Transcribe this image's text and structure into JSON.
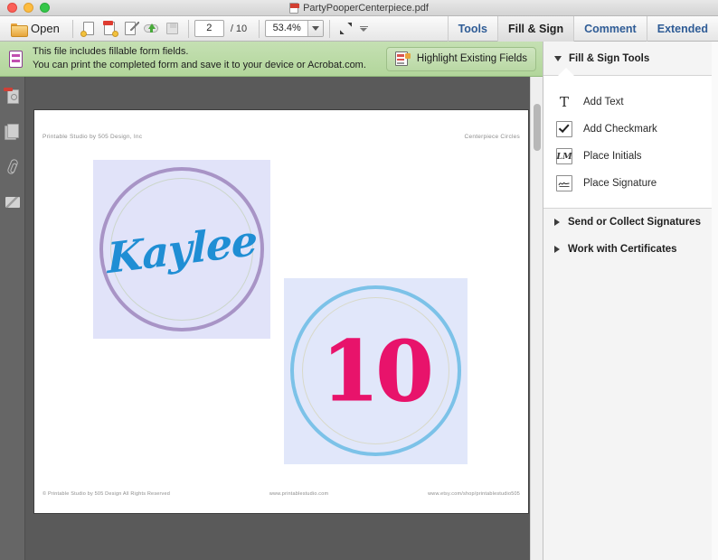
{
  "window": {
    "title": "PartyPooperCenterpiece.pdf",
    "doc_icon": "pdf-file-icon",
    "controls": {
      "close": "close-window-button",
      "minimize": "minimize-window-button",
      "maximize": "maximize-window-button"
    }
  },
  "toolbar": {
    "open_label": "Open",
    "open_icon": "folder-open-icon",
    "icons": [
      {
        "name": "save-a-copy-icon"
      },
      {
        "name": "attach-file-icon"
      },
      {
        "name": "edit-pdf-icon"
      },
      {
        "name": "upload-to-cloud-icon"
      },
      {
        "name": "save-file-icon"
      }
    ],
    "page_number": "2",
    "page_total": "/ 10",
    "zoom_value": "53.4%",
    "zoom_dropdown_icon": "chevron-down-icon",
    "fit_icon": "fit-page-icon",
    "overflow_icon": "toolbar-overflow-icon",
    "menus": [
      {
        "label": "Tools",
        "active": false
      },
      {
        "label": "Fill & Sign",
        "active": true
      },
      {
        "label": "Comment",
        "active": false
      },
      {
        "label": "Extended",
        "active": false
      }
    ]
  },
  "notification": {
    "icon": "form-fields-icon",
    "line1": "This file includes fillable form fields.",
    "line2": "You can print the completed form and save it to your device or Acrobat.com.",
    "button_label": "Highlight Existing Fields",
    "button_icon": "highlight-fields-icon",
    "background_color": "#b2d69b"
  },
  "left_rail": {
    "items": [
      {
        "name": "page-thumbnails-icon"
      },
      {
        "name": "pages-panel-icon"
      },
      {
        "name": "attachments-icon"
      },
      {
        "name": "signatures-icon"
      }
    ]
  },
  "document": {
    "header_left": "Printable Studio by 505 Design, Inc",
    "header_right": "Centerpiece Circles",
    "footer_left": "© Printable Studio by 505 Design All Rights Reserved",
    "footer_center": "www.printablestudio.com",
    "footer_right": "www.etsy.com/shop/printablestudio505",
    "tiles": [
      {
        "name": "centerpiece-circle-kaylee",
        "label": "Kaylee",
        "background": "#e1e3f9",
        "ring_color": "#a894c6",
        "inner_ring_color": "#cfd8d0",
        "text_color": "#1f8ed4"
      },
      {
        "name": "centerpiece-circle-ten",
        "label": "10",
        "background": "#e1e7fa",
        "ring_color": "#7cc2e8",
        "inner_ring_color": "#d7d8c8",
        "text_color": "#e8136b"
      }
    ]
  },
  "right_panel": {
    "header": {
      "label": "Fill & Sign Tools",
      "toggle_icon": "triangle-down-icon"
    },
    "tools": [
      {
        "label": "Add Text",
        "icon": "add-text-icon"
      },
      {
        "label": "Add Checkmark",
        "icon": "add-checkmark-icon"
      },
      {
        "label": "Place Initials",
        "icon": "place-initials-icon"
      },
      {
        "label": "Place Signature",
        "icon": "place-signature-icon"
      }
    ],
    "sections": [
      {
        "label": "Send or Collect Signatures",
        "icon": "triangle-right-icon"
      },
      {
        "label": "Work with Certificates",
        "icon": "triangle-right-icon"
      }
    ]
  },
  "scrollbars": {
    "viewer": "viewer-vertical-scrollbar",
    "panel": "panel-vertical-scrollbar"
  }
}
